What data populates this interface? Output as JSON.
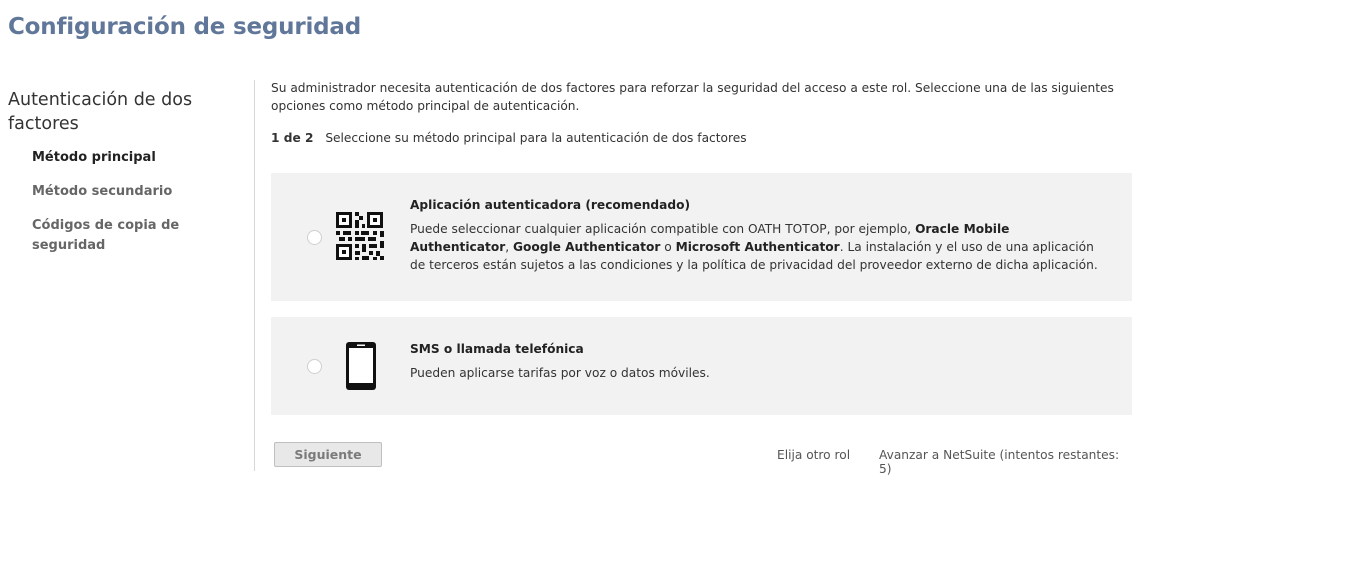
{
  "page": {
    "title": "Configuración de seguridad"
  },
  "sidebar": {
    "heading": "Autenticación de dos factores",
    "steps": [
      {
        "label": "Método principal",
        "active": true
      },
      {
        "label": "Método secundario",
        "active": false
      },
      {
        "label": "Códigos de copia de seguridad",
        "active": false
      }
    ]
  },
  "main": {
    "intro": "Su administrador necesita autenticación de dos factores para reforzar la seguridad del acceso a este rol. Seleccione una de las siguientes opciones como método principal de autenticación.",
    "step_number": "1 de 2",
    "step_text": "Seleccione su método principal para la autenticación de dos factores",
    "options": [
      {
        "icon": "qr-code-icon",
        "title": "Aplicación autenticadora (recomendado)",
        "desc_1": "Puede seleccionar cualquier aplicación compatible con OATH TOTOP, por ejemplo, ",
        "desc_app_1": "Oracle Mobile Authenticator",
        "desc_2": ", ",
        "desc_app_2": "Google Authenticator",
        "desc_3": " o ",
        "desc_app_3": "Microsoft Authenticator",
        "desc_4": ". La instalación y el uso de una aplicación de terceros están sujetos a las condiciones y la política de privacidad del proveedor externo de dicha aplicación."
      },
      {
        "icon": "smartphone-icon",
        "title": "SMS o llamada telefónica",
        "desc": "Pueden aplicarse tarifas por voz o datos móviles."
      }
    ],
    "next_label": "Siguiente",
    "other_role_label": "Elija otro rol",
    "skip_label": "Avanzar a NetSuite (intentos restantes: 5)"
  },
  "colors": {
    "title": "#607799",
    "option_bg": "#f2f2f2",
    "divider": "#d7d7d7"
  }
}
